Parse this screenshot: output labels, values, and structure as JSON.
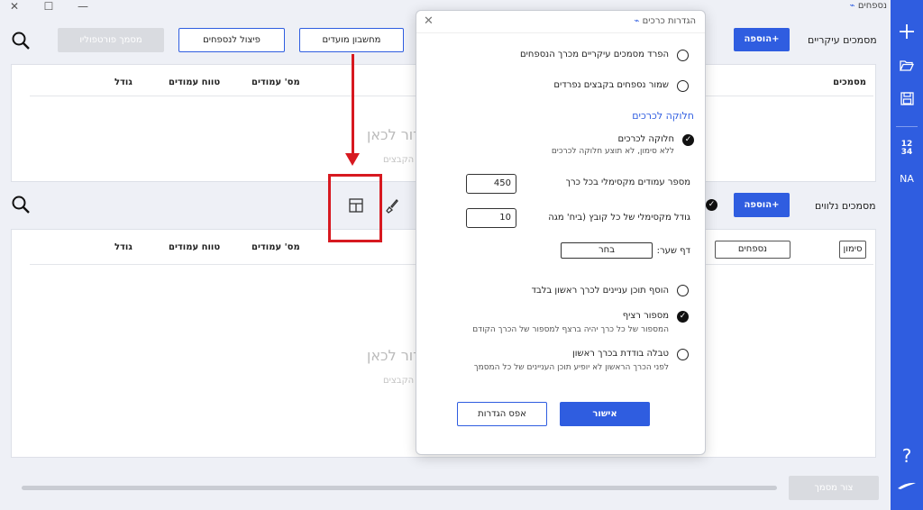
{
  "app": {
    "title": "נספחים"
  },
  "window_controls": {
    "close": "✕",
    "maximize": "☐",
    "minimize": "—"
  },
  "top_section": {
    "label": "מסמכים עיקריים",
    "add_button": "הוספה+",
    "buttons": [
      "מחשבון מועדים",
      "פיצול לנספחים",
      "מסמך פורטפוליו"
    ],
    "columns": [
      "מסמכים",
      "מס' עמודים",
      "טווח עמודים",
      "גודל"
    ],
    "ghost_text": "דור לכאן",
    "ghost_sub": "הקבצים"
  },
  "bottom_section": {
    "label": "מסמכים נלווים",
    "add_button": "הוספה+",
    "tag_marker": "סימון",
    "tag_appendices": "נספחים",
    "columns": [
      "מס' עמודים",
      "טווח עמודים",
      "גודל"
    ],
    "ghost_text": "דור לכאן",
    "ghost_sub": "הקבצים"
  },
  "footer": {
    "create_button": "צור מסמך"
  },
  "dialog": {
    "title": "הגדרות כרכים",
    "close": "✕",
    "opt_separate": "הפרד מסמכים עיקריים מכרך הנספחים",
    "opt_save_separate": "שמור נספחים בקבצים נפרדים",
    "section_volumes": "חלוקה לכרכים",
    "opt_split": "חלוקה לכרכים",
    "opt_split_sub": "ללא סימון, לא תוצע חלוקה לכרכים",
    "max_pages_label": "מספר עמודים מקסימלי בכל כרך",
    "max_pages_value": "450",
    "max_size_label": "גודל מקסימלי של כל קובץ (ביח' מגה",
    "max_size_value": "10",
    "cover_label": "דף שער:",
    "cover_select": "בחר",
    "opt_toc_first": "הוסף תוכן עניינים לכרך ראשון בלבד",
    "opt_continuous": "מספור רציף",
    "opt_continuous_sub": "המספור של כל כרך יהיה ברצף למספור של הכרך הקודם",
    "opt_single_table": "טבלה בודדת בכרך ראשון",
    "opt_single_table_sub": "לפני הכרך הראשון לא יופיע תוכן העניינים של כל המסמך",
    "ok_button": "אישור",
    "reset_button": "אפס הגדרות"
  },
  "sidebar_labels": {
    "numbers": "12 34",
    "lang": "NA",
    "help": "?"
  },
  "colors": {
    "accent": "#2f5de0",
    "annotation": "#d71920"
  }
}
